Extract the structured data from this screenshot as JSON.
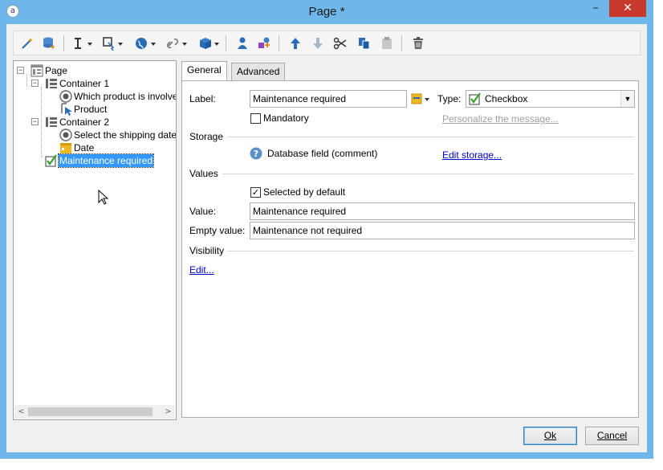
{
  "window": {
    "title": "Page",
    "modified_marker": "*",
    "app_icon": "adobe-campaign-icon",
    "minimize_glyph": "–",
    "close_glyph": "✕"
  },
  "toolbar": {
    "icons": [
      "wizard-wand-icon",
      "database-user-icon",
      "text-cursor-icon",
      "select-box-icon",
      "globe-icon",
      "link-icon",
      "package-icon",
      "user-icon",
      "shapes-icon",
      "arrow-up-icon",
      "arrow-down-icon",
      "cut-icon",
      "copy-icon",
      "paste-icon",
      "delete-icon"
    ]
  },
  "tree": {
    "nodes": [
      {
        "label": "Page",
        "icon": "page-icon",
        "expander": "−"
      },
      {
        "label": "Container 1",
        "icon": "container-icon",
        "expander": "−"
      },
      {
        "label": "Which product is involve",
        "icon": "radio-icon"
      },
      {
        "label": "Product",
        "icon": "cursor-select-icon"
      },
      {
        "label": "Container 2",
        "icon": "container-icon",
        "expander": "−"
      },
      {
        "label": "Select the shipping date",
        "icon": "radio-icon"
      },
      {
        "label": "Date",
        "icon": "calendar-icon"
      },
      {
        "label": "Maintenance required",
        "icon": "checkbox-icon",
        "selected": true
      }
    ],
    "scroll_left": "<",
    "scroll_right": ">"
  },
  "tabs": [
    {
      "label": "General",
      "active": true
    },
    {
      "label": "Advanced",
      "active": false
    }
  ],
  "general": {
    "label_caption": "Label:",
    "label_value": "Maintenance required",
    "type_caption": "Type:",
    "type_value": "Checkbox",
    "mandatory_label": "Mandatory",
    "mandatory_checked": false,
    "personalize_link": "Personalize the message...",
    "storage_section": "Storage",
    "storage_field": "Database field (comment)",
    "edit_storage_link": "Edit storage...",
    "values_section": "Values",
    "selected_default_label": "Selected by default",
    "selected_default_checked": true,
    "value_caption": "Value:",
    "value_value": "Maintenance required",
    "empty_caption": "Empty value:",
    "empty_value": "Maintenance not required",
    "visibility_section": "Visibility",
    "edit_visibility_link": "Edit..."
  },
  "buttons": {
    "ok": "Ok",
    "cancel": "Cancel"
  },
  "colors": {
    "title_bar": "#6fb7ea",
    "close_button": "#c7392b",
    "selection": "#3399ff",
    "link": "#0000cc"
  }
}
